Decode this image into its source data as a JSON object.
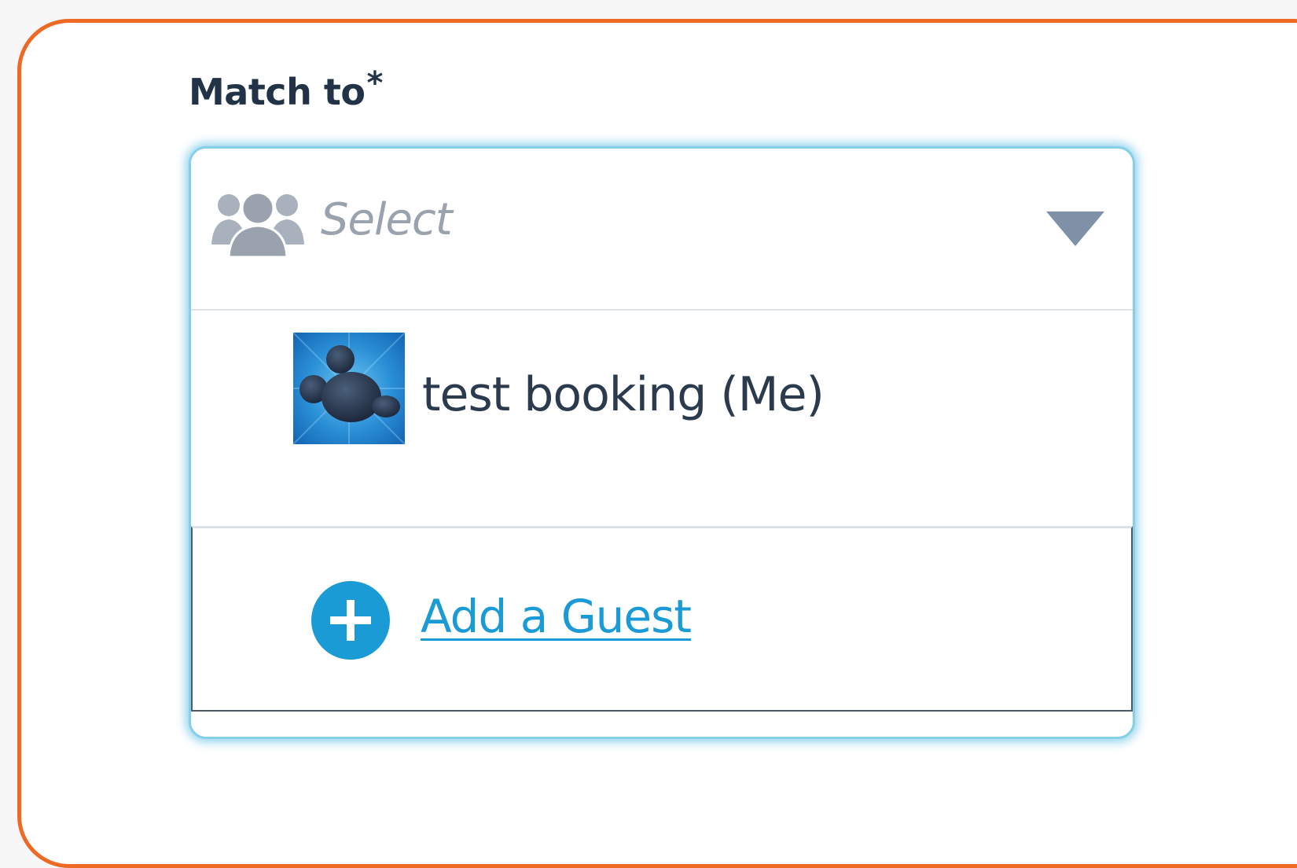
{
  "form": {
    "label": "Match to",
    "required_mark": "*"
  },
  "dropdown": {
    "placeholder": "Select",
    "leading_icon": "group-icon",
    "trailing_icon": "caret-down-icon",
    "options": [
      {
        "label": "test booking (Me)",
        "avatar": "character-avatar-icon"
      }
    ],
    "add_guest": {
      "label": "Add a Guest",
      "icon": "plus-circle-icon"
    }
  },
  "colors": {
    "card_border": "#ee6a24",
    "focus_glow": "#86cfe9",
    "link": "#1b9bd5",
    "muted_icon": "#9aa3ad"
  }
}
